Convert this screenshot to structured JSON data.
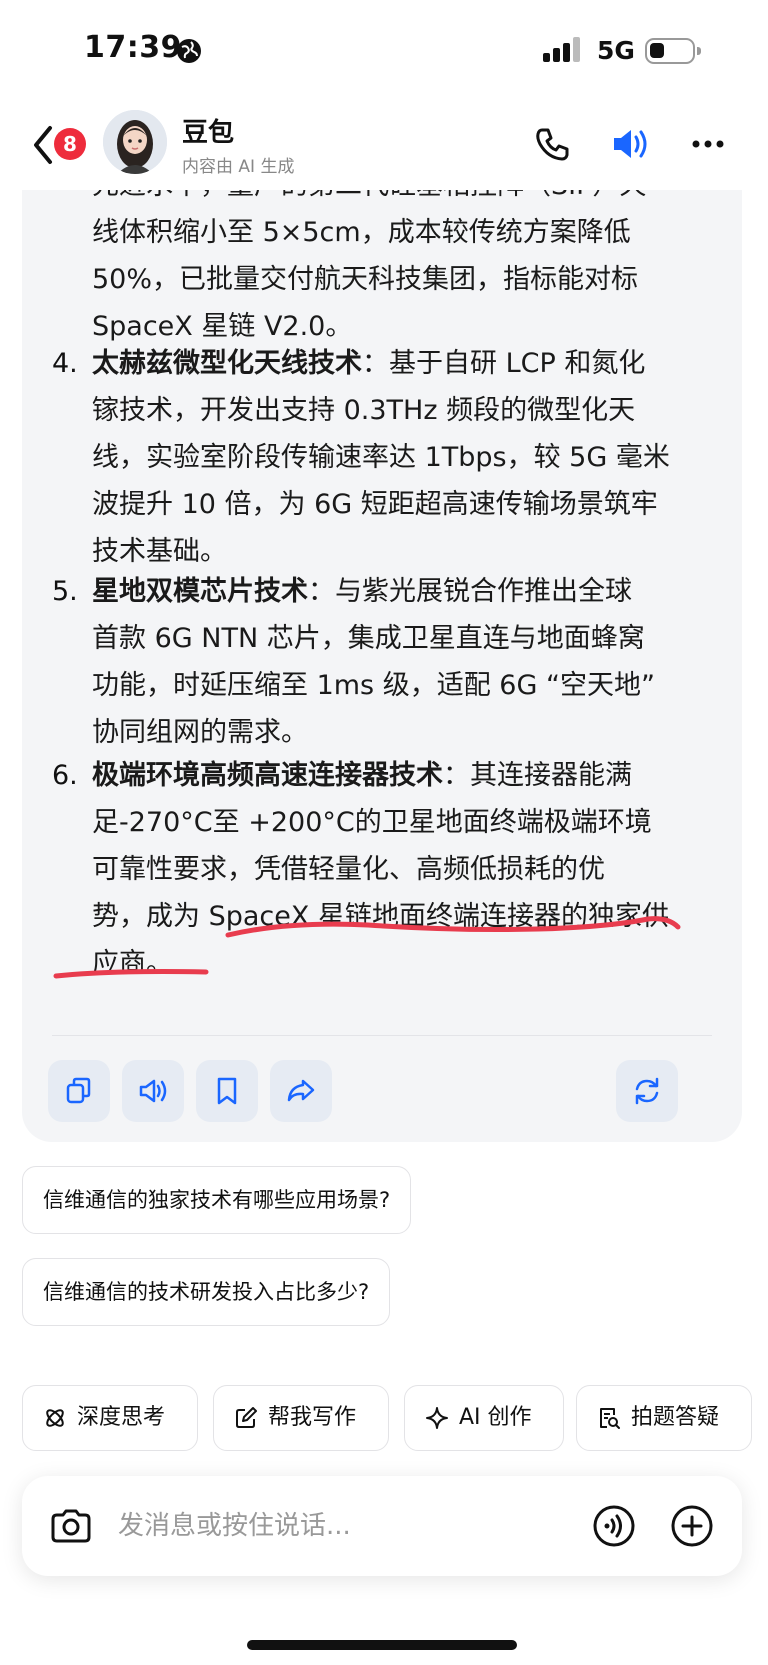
{
  "status_bar": {
    "time": "17:39",
    "network": "5G",
    "signal_bars": 4,
    "battery_level": 0.25
  },
  "header": {
    "unread_count": "8",
    "bot_name": "豆包",
    "bot_subtitle": "内容由 AI 生成",
    "icons": [
      "back-chevron-icon",
      "phone-icon",
      "speaker-icon",
      "more-icon"
    ],
    "speaker_color": "#1a66ff"
  },
  "message": {
    "item3_tail": [
      "先进水平，量产的第二代硅基相控阵（SIP）天",
      "线体积缩小至 5×5cm，成本较传统方案降低",
      "50%，已批量交付航天科技集团，指标能对标",
      "SpaceX 星链 V2.0。"
    ],
    "items": [
      {
        "number": "4.",
        "title": "太赫兹微型化天线技术",
        "lines": [
          "：基于自研 LCP 和氮化",
          "镓技术，开发出支持 0.3THz 频段的微型化天",
          "线，实验室阶段传输速率达 1Tbps，较 5G 毫米",
          "波提升 10 倍，为 6G 短距超高速传输场景筑牢",
          "技术基础。"
        ]
      },
      {
        "number": "5.",
        "title": "星地双模芯片技术",
        "lines": [
          "：与紫光展锐合作推出全球",
          "首款 6G NTN 芯片，集成卫星直连与地面蜂窝",
          "功能，时延压缩至 1ms 级，适配 6G “空天地”",
          "协同组网的需求。"
        ]
      },
      {
        "number": "6.",
        "title": "极端环境高频高速连接器技术",
        "lines": [
          "：其连接器能满",
          "足-270°C至 +200°C的卫星地面终端极端环境",
          "可靠性要求，凭借轻量化、高频低损耗的优",
          "势，成为 SpaceX 星链地面终端连接器的独家供",
          "应商。"
        ]
      }
    ],
    "action_icons": [
      "copy-icon",
      "read-aloud-icon",
      "bookmark-icon",
      "share-icon",
      "regenerate-icon"
    ],
    "accent_color": "#1a66ff",
    "annotation_color": "#e83c4e"
  },
  "suggestions": [
    "信维通信的独家技术有哪些应用场景?",
    "信维通信的技术研发投入占比多少?"
  ],
  "quick_actions": [
    {
      "label": "深度思考",
      "icon": "atom-icon"
    },
    {
      "label": "帮我写作",
      "icon": "edit-icon"
    },
    {
      "label": "AI 创作",
      "icon": "sparkle-icon"
    },
    {
      "label": "拍题答疑",
      "icon": "scan-doc-icon"
    }
  ],
  "input": {
    "placeholder": "发消息或按住说话..."
  }
}
